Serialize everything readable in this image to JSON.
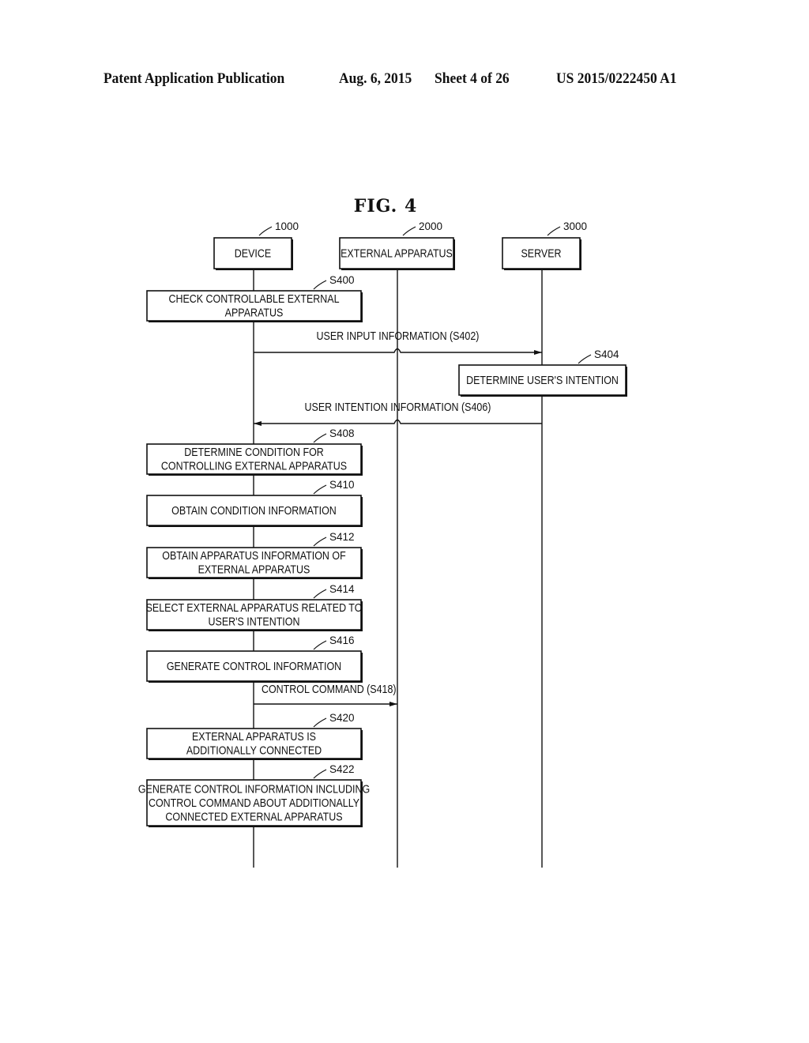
{
  "header": {
    "publication": "Patent Application Publication",
    "date": "Aug. 6, 2015",
    "sheet": "Sheet 4 of 26",
    "patent_number": "US 2015/0222450 A1"
  },
  "figure": {
    "title": "FIG.  4",
    "participants": [
      {
        "ref": "1000",
        "label": "DEVICE"
      },
      {
        "ref": "2000",
        "label": "EXTERNAL APPARATUS"
      },
      {
        "ref": "3000",
        "label": "SERVER"
      }
    ],
    "steps": [
      {
        "id": "S400",
        "actor": 0,
        "lines": [
          "CHECK CONTROLLABLE EXTERNAL",
          "APPARATUS"
        ]
      },
      {
        "id": "S402",
        "type": "message",
        "from": 0,
        "to": 2,
        "label": "USER INPUT INFORMATION (S402)"
      },
      {
        "id": "S404",
        "actor": 2,
        "lines": [
          "DETERMINE USER'S INTENTION"
        ]
      },
      {
        "id": "S406",
        "type": "message",
        "from": 2,
        "to": 0,
        "label": "USER INTENTION INFORMATION (S406)"
      },
      {
        "id": "S408",
        "actor": 0,
        "lines": [
          "DETERMINE CONDITION FOR",
          "CONTROLLING EXTERNAL APPARATUS"
        ]
      },
      {
        "id": "S410",
        "actor": 0,
        "lines": [
          "OBTAIN CONDITION INFORMATION"
        ]
      },
      {
        "id": "S412",
        "actor": 0,
        "lines": [
          "OBTAIN APPARATUS INFORMATION OF",
          "EXTERNAL APPARATUS"
        ]
      },
      {
        "id": "S414",
        "actor": 0,
        "lines": [
          "SELECT EXTERNAL APPARATUS RELATED TO",
          "USER'S INTENTION"
        ]
      },
      {
        "id": "S416",
        "actor": 0,
        "lines": [
          "GENERATE CONTROL INFORMATION"
        ]
      },
      {
        "id": "S418",
        "type": "message",
        "from": 0,
        "to": 1,
        "label": "CONTROL COMMAND (S418)"
      },
      {
        "id": "S420",
        "actor": 0,
        "lines": [
          "EXTERNAL APPARATUS IS",
          "ADDITIONALLY CONNECTED"
        ]
      },
      {
        "id": "S422",
        "actor": 0,
        "lines": [
          "GENERATE CONTROL INFORMATION INCLUDING",
          "CONTROL COMMAND ABOUT ADDITIONALLY",
          "CONNECTED EXTERNAL APPARATUS"
        ]
      }
    ]
  }
}
